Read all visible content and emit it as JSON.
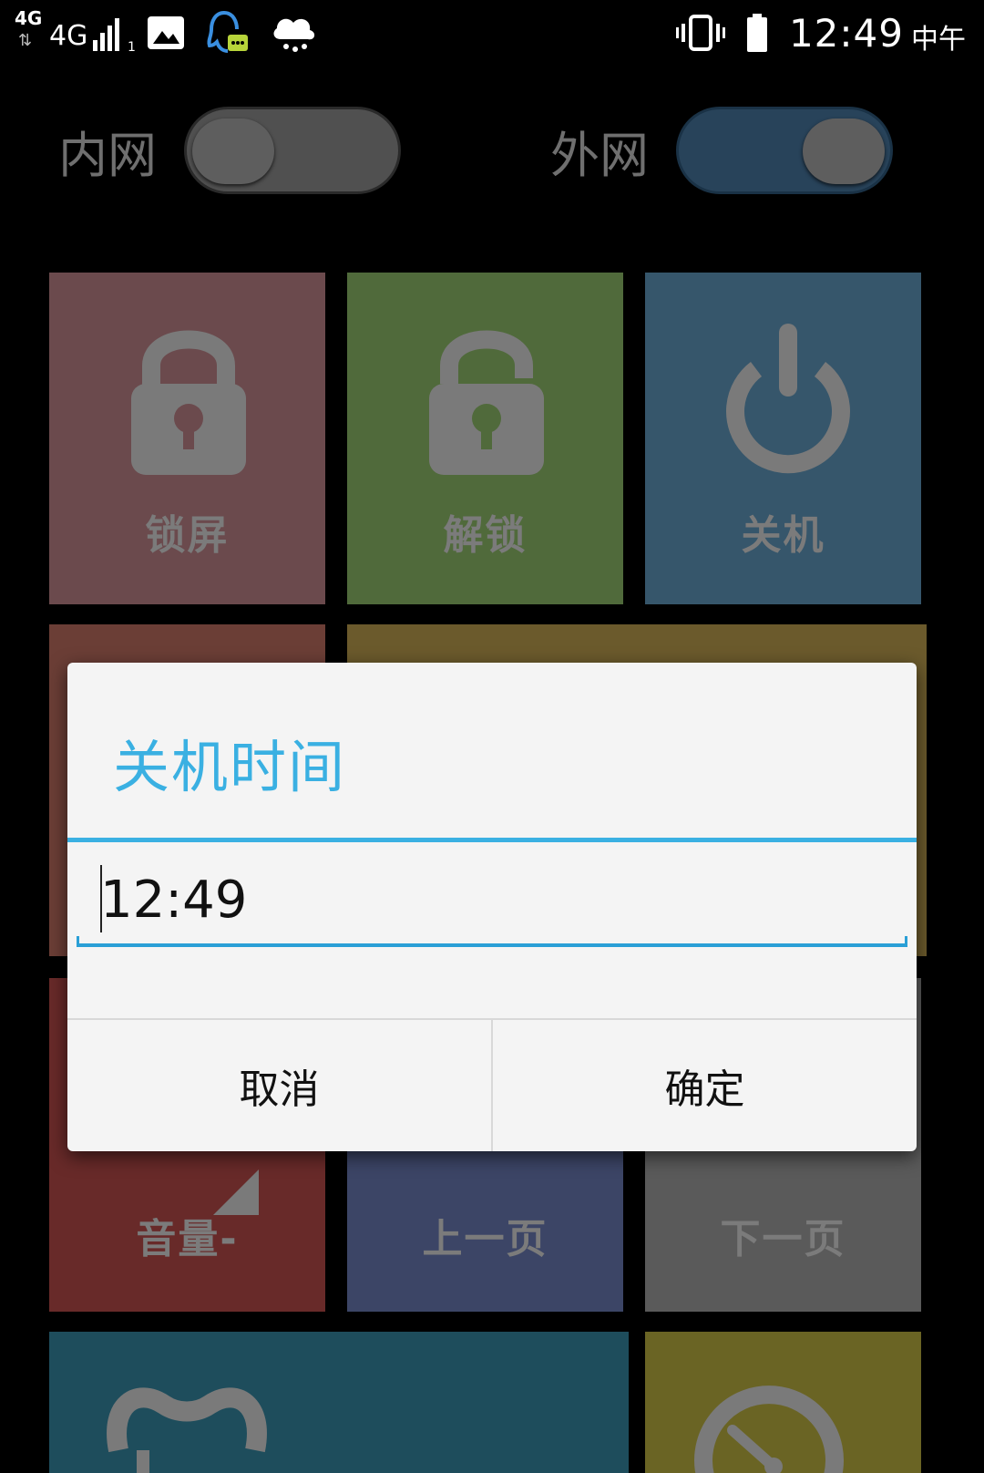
{
  "status_bar": {
    "network_small": "4G",
    "network_main": "4G",
    "sim_slot": "1",
    "time": "12:49",
    "period": "中午",
    "icons": [
      "image-icon",
      "qq-icon",
      "weather-icon",
      "vibrate-icon",
      "battery-icon"
    ]
  },
  "toggles": {
    "intranet_label": "内网",
    "intranet_on": false,
    "extranet_label": "外网",
    "extranet_on": true
  },
  "tiles": {
    "lock": "锁屏",
    "unlock": "解锁",
    "shutdown": "关机",
    "volume_down": "音量-",
    "prev_page": "上一页",
    "next_page": "下一页"
  },
  "dialog": {
    "title": "关机时间",
    "input_value": "12:49",
    "cancel": "取消",
    "confirm": "确定"
  },
  "colors": {
    "accent": "#3ab0e2",
    "tile_lock": "#6b4a4d",
    "tile_unlock": "#506a3b",
    "tile_shutdown": "#36566b",
    "tile_row2_left": "#6b3e36",
    "tile_row2_right": "#6b5a2c",
    "tile_volume": "#682a29",
    "tile_prev": "#3c4566",
    "tile_next": "#5a5a5a",
    "tile_bottom_left": "#1e4d5c",
    "tile_bottom_right": "#6a6424"
  }
}
